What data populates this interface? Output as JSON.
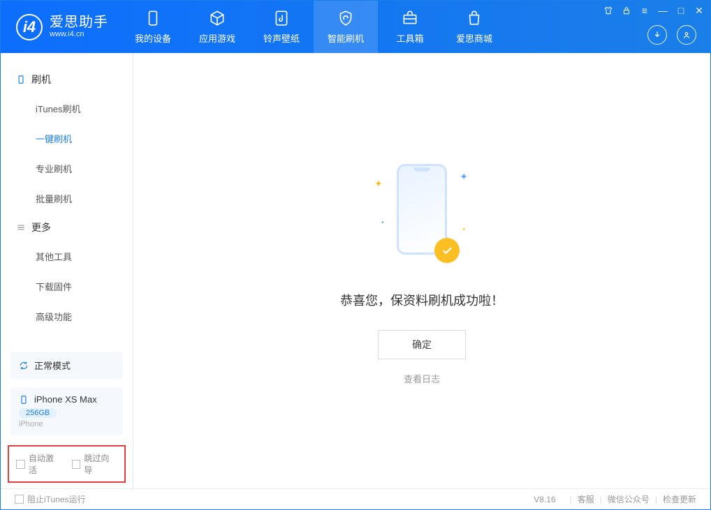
{
  "logo": {
    "title": "爱思助手",
    "subtitle": "www.i4.cn"
  },
  "tabs": [
    {
      "label": "我的设备"
    },
    {
      "label": "应用游戏"
    },
    {
      "label": "铃声壁纸"
    },
    {
      "label": "智能刷机"
    },
    {
      "label": "工具箱"
    },
    {
      "label": "爱思商城"
    }
  ],
  "sidebar": {
    "section1": "刷机",
    "items1": [
      "iTunes刷机",
      "一键刷机",
      "专业刷机",
      "批量刷机"
    ],
    "section2": "更多",
    "items2": [
      "其他工具",
      "下载固件",
      "高级功能"
    ]
  },
  "mode_box": "正常模式",
  "device": {
    "name": "iPhone XS Max",
    "storage": "256GB",
    "type": "iPhone"
  },
  "checks": {
    "auto_activate": "自动激活",
    "skip_guide": "跳过向导"
  },
  "main": {
    "success": "恭喜您，保资料刷机成功啦！",
    "confirm": "确定",
    "view_log": "查看日志"
  },
  "footer": {
    "block_itunes": "阻止iTunes运行",
    "version": "V8.16",
    "service": "客服",
    "wechat": "微信公众号",
    "update": "检查更新"
  }
}
